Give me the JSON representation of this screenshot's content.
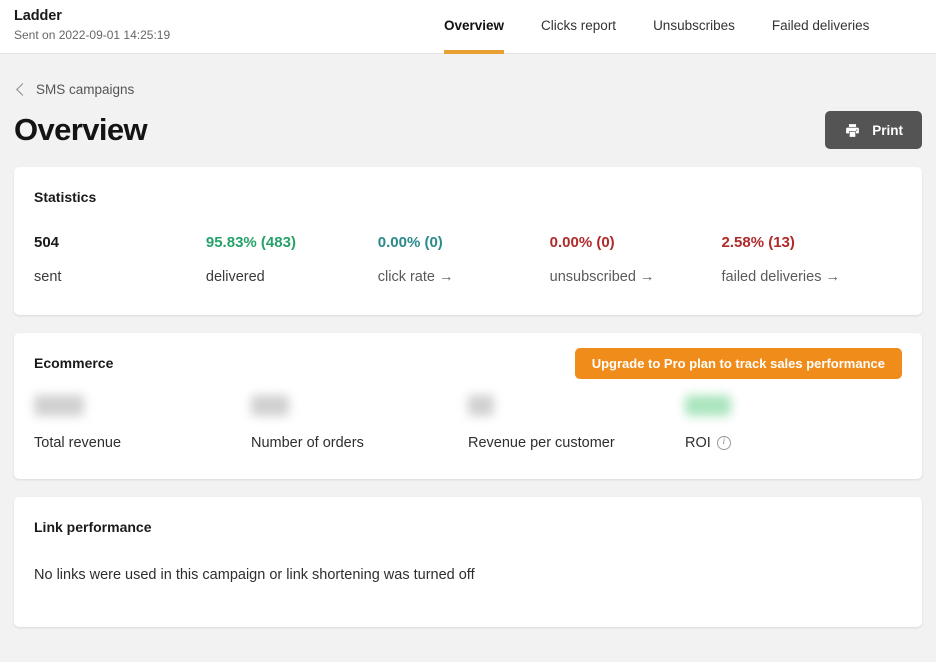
{
  "header": {
    "campaign_name": "Ladder",
    "sent_info": "Sent on 2022-09-01 14:25:19",
    "tabs": [
      {
        "label": "Overview",
        "active": true
      },
      {
        "label": "Clicks report",
        "active": false
      },
      {
        "label": "Unsubscribes",
        "active": false
      },
      {
        "label": "Failed deliveries",
        "active": false
      }
    ]
  },
  "breadcrumb": {
    "back_icon": "chevron-left-icon",
    "label": "SMS campaigns"
  },
  "page": {
    "title": "Overview",
    "print_button": {
      "label": "Print",
      "icon": "printer-icon"
    }
  },
  "statistics": {
    "title": "Statistics",
    "items": [
      {
        "value": "504",
        "label": "sent",
        "color": "#1a1a1a",
        "link": false,
        "arrow": ""
      },
      {
        "value": "95.83% (483)",
        "label": "delivered",
        "color": "#26a269",
        "link": false,
        "arrow": ""
      },
      {
        "value": "0.00% (0)",
        "label": "click rate",
        "color": "#2a8a8c",
        "link": true,
        "arrow": "→"
      },
      {
        "value": "0.00% (0)",
        "label": "unsubscribed",
        "color": "#b02a2a",
        "link": true,
        "arrow": "→"
      },
      {
        "value": "2.58% (13)",
        "label": "failed deliveries",
        "color": "#b02a2a",
        "link": true,
        "arrow": "→"
      }
    ]
  },
  "ecommerce": {
    "title": "Ecommerce",
    "upgrade_label": "Upgrade to Pro plan to track sales performance",
    "items": [
      {
        "label": "Total revenue",
        "locked": true,
        "info": false
      },
      {
        "label": "Number of orders",
        "locked": true,
        "info": false
      },
      {
        "label": "Revenue per customer",
        "locked": true,
        "info": false
      },
      {
        "label": "ROI",
        "locked": true,
        "info": true
      }
    ]
  },
  "link_performance": {
    "title": "Link performance",
    "empty_message": "No links were used in this campaign or link shortening was turned off"
  },
  "colors": {
    "accent_orange": "#e9a032",
    "cta_orange": "#f08c1a",
    "green": "#26a269",
    "teal": "#2a8a8c",
    "red": "#b02a2a",
    "dark_button": "#545454",
    "page_background": "#f2f2f2"
  }
}
